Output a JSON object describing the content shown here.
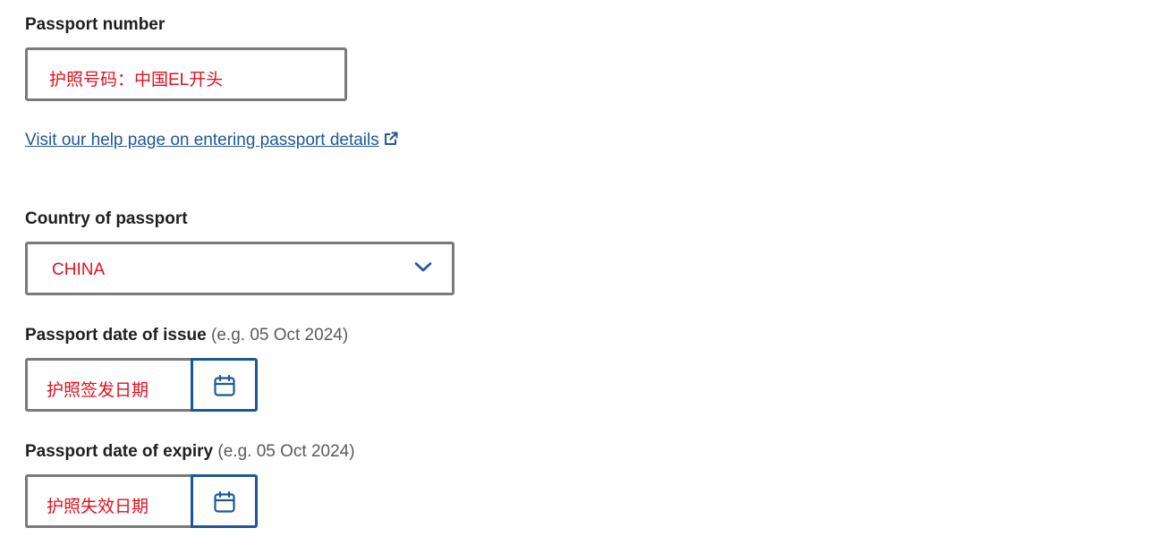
{
  "passport_number": {
    "label": "Passport number",
    "value": "护照号码：中国EL开头"
  },
  "help_link": {
    "text": "Visit our help page on entering passport details"
  },
  "country": {
    "label": "Country of passport",
    "selected": "CHINA"
  },
  "date_of_issue": {
    "label": "Passport date of issue",
    "hint": "(e.g. 05 Oct 2024)",
    "value": "护照签发日期"
  },
  "date_of_expiry": {
    "label": "Passport date of expiry",
    "hint": "(e.g. 05 Oct 2024)",
    "value": "护照失效日期"
  },
  "colors": {
    "link": "#1d5799",
    "annotation_red": "#e0101e",
    "border": "#7a7a7a"
  },
  "icons": [
    "external-link-icon",
    "chevron-down-icon",
    "calendar-icon"
  ]
}
